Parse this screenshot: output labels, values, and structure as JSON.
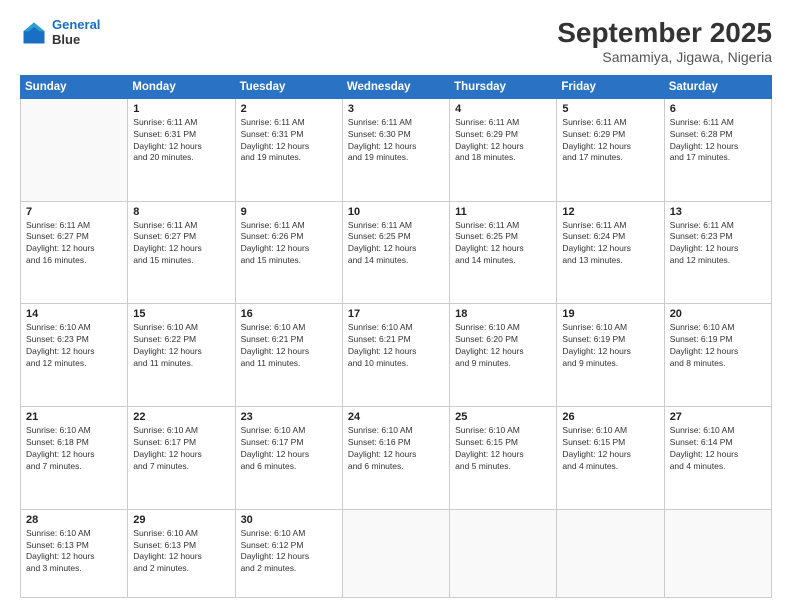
{
  "logo": {
    "line1": "General",
    "line2": "Blue"
  },
  "header": {
    "month": "September 2025",
    "location": "Samamiya, Jigawa, Nigeria"
  },
  "days_of_week": [
    "Sunday",
    "Monday",
    "Tuesday",
    "Wednesday",
    "Thursday",
    "Friday",
    "Saturday"
  ],
  "weeks": [
    [
      {
        "day": "",
        "info": ""
      },
      {
        "day": "1",
        "info": "Sunrise: 6:11 AM\nSunset: 6:31 PM\nDaylight: 12 hours\nand 20 minutes."
      },
      {
        "day": "2",
        "info": "Sunrise: 6:11 AM\nSunset: 6:31 PM\nDaylight: 12 hours\nand 19 minutes."
      },
      {
        "day": "3",
        "info": "Sunrise: 6:11 AM\nSunset: 6:30 PM\nDaylight: 12 hours\nand 19 minutes."
      },
      {
        "day": "4",
        "info": "Sunrise: 6:11 AM\nSunset: 6:29 PM\nDaylight: 12 hours\nand 18 minutes."
      },
      {
        "day": "5",
        "info": "Sunrise: 6:11 AM\nSunset: 6:29 PM\nDaylight: 12 hours\nand 17 minutes."
      },
      {
        "day": "6",
        "info": "Sunrise: 6:11 AM\nSunset: 6:28 PM\nDaylight: 12 hours\nand 17 minutes."
      }
    ],
    [
      {
        "day": "7",
        "info": "Sunrise: 6:11 AM\nSunset: 6:27 PM\nDaylight: 12 hours\nand 16 minutes."
      },
      {
        "day": "8",
        "info": "Sunrise: 6:11 AM\nSunset: 6:27 PM\nDaylight: 12 hours\nand 15 minutes."
      },
      {
        "day": "9",
        "info": "Sunrise: 6:11 AM\nSunset: 6:26 PM\nDaylight: 12 hours\nand 15 minutes."
      },
      {
        "day": "10",
        "info": "Sunrise: 6:11 AM\nSunset: 6:25 PM\nDaylight: 12 hours\nand 14 minutes."
      },
      {
        "day": "11",
        "info": "Sunrise: 6:11 AM\nSunset: 6:25 PM\nDaylight: 12 hours\nand 14 minutes."
      },
      {
        "day": "12",
        "info": "Sunrise: 6:11 AM\nSunset: 6:24 PM\nDaylight: 12 hours\nand 13 minutes."
      },
      {
        "day": "13",
        "info": "Sunrise: 6:11 AM\nSunset: 6:23 PM\nDaylight: 12 hours\nand 12 minutes."
      }
    ],
    [
      {
        "day": "14",
        "info": "Sunrise: 6:10 AM\nSunset: 6:23 PM\nDaylight: 12 hours\nand 12 minutes."
      },
      {
        "day": "15",
        "info": "Sunrise: 6:10 AM\nSunset: 6:22 PM\nDaylight: 12 hours\nand 11 minutes."
      },
      {
        "day": "16",
        "info": "Sunrise: 6:10 AM\nSunset: 6:21 PM\nDaylight: 12 hours\nand 11 minutes."
      },
      {
        "day": "17",
        "info": "Sunrise: 6:10 AM\nSunset: 6:21 PM\nDaylight: 12 hours\nand 10 minutes."
      },
      {
        "day": "18",
        "info": "Sunrise: 6:10 AM\nSunset: 6:20 PM\nDaylight: 12 hours\nand 9 minutes."
      },
      {
        "day": "19",
        "info": "Sunrise: 6:10 AM\nSunset: 6:19 PM\nDaylight: 12 hours\nand 9 minutes."
      },
      {
        "day": "20",
        "info": "Sunrise: 6:10 AM\nSunset: 6:19 PM\nDaylight: 12 hours\nand 8 minutes."
      }
    ],
    [
      {
        "day": "21",
        "info": "Sunrise: 6:10 AM\nSunset: 6:18 PM\nDaylight: 12 hours\nand 7 minutes."
      },
      {
        "day": "22",
        "info": "Sunrise: 6:10 AM\nSunset: 6:17 PM\nDaylight: 12 hours\nand 7 minutes."
      },
      {
        "day": "23",
        "info": "Sunrise: 6:10 AM\nSunset: 6:17 PM\nDaylight: 12 hours\nand 6 minutes."
      },
      {
        "day": "24",
        "info": "Sunrise: 6:10 AM\nSunset: 6:16 PM\nDaylight: 12 hours\nand 6 minutes."
      },
      {
        "day": "25",
        "info": "Sunrise: 6:10 AM\nSunset: 6:15 PM\nDaylight: 12 hours\nand 5 minutes."
      },
      {
        "day": "26",
        "info": "Sunrise: 6:10 AM\nSunset: 6:15 PM\nDaylight: 12 hours\nand 4 minutes."
      },
      {
        "day": "27",
        "info": "Sunrise: 6:10 AM\nSunset: 6:14 PM\nDaylight: 12 hours\nand 4 minutes."
      }
    ],
    [
      {
        "day": "28",
        "info": "Sunrise: 6:10 AM\nSunset: 6:13 PM\nDaylight: 12 hours\nand 3 minutes."
      },
      {
        "day": "29",
        "info": "Sunrise: 6:10 AM\nSunset: 6:13 PM\nDaylight: 12 hours\nand 2 minutes."
      },
      {
        "day": "30",
        "info": "Sunrise: 6:10 AM\nSunset: 6:12 PM\nDaylight: 12 hours\nand 2 minutes."
      },
      {
        "day": "",
        "info": ""
      },
      {
        "day": "",
        "info": ""
      },
      {
        "day": "",
        "info": ""
      },
      {
        "day": "",
        "info": ""
      }
    ]
  ]
}
